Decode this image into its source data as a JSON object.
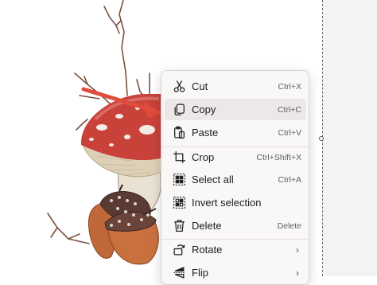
{
  "context_menu": {
    "items": [
      {
        "label": "Cut",
        "shortcut": "Ctrl+X",
        "icon": "scissors-icon"
      },
      {
        "label": "Copy",
        "shortcut": "Ctrl+C",
        "icon": "copy-icon",
        "highlighted": true
      },
      {
        "label": "Paste",
        "shortcut": "Ctrl+V",
        "icon": "paste-icon"
      },
      {
        "label": "Crop",
        "shortcut": "Ctrl+Shift+X",
        "icon": "crop-icon"
      },
      {
        "label": "Select all",
        "shortcut": "Ctrl+A",
        "icon": "select-all-icon"
      },
      {
        "label": "Invert selection",
        "shortcut": "",
        "icon": "invert-selection-icon"
      },
      {
        "label": "Delete",
        "shortcut": "Delete",
        "icon": "trash-icon"
      },
      {
        "label": "Rotate",
        "submenu": true,
        "icon": "rotate-icon"
      },
      {
        "label": "Flip",
        "submenu": true,
        "icon": "flip-icon"
      }
    ]
  },
  "colors": {
    "menu_background": "#faf7f7",
    "menu_hover": "#ece8e8",
    "pointer_arrow": "#e04c3c"
  }
}
